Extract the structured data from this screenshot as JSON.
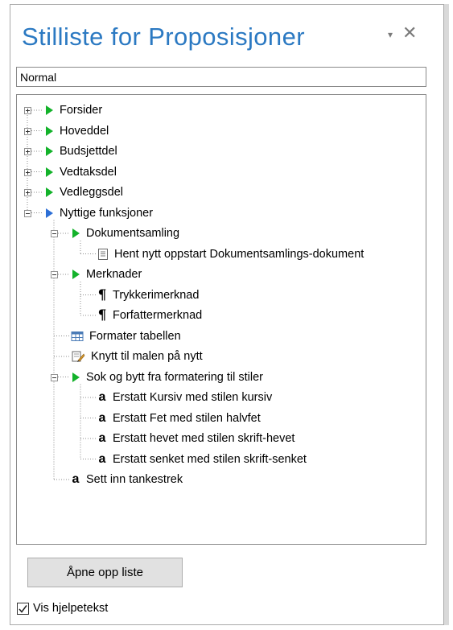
{
  "pane": {
    "title": "Stilliste for Proposisjoner",
    "dropdown_glyph": "▾",
    "close_glyph": "✕"
  },
  "style_input": {
    "value": "Normal"
  },
  "tree": {
    "items": [
      {
        "label": "Forsider",
        "icon": "green-triangle-icon",
        "expander": "plus"
      },
      {
        "label": "Hoveddel",
        "icon": "green-triangle-icon",
        "expander": "plus"
      },
      {
        "label": "Budsjettdel",
        "icon": "green-triangle-icon",
        "expander": "plus"
      },
      {
        "label": "Vedtaksdel",
        "icon": "green-triangle-icon",
        "expander": "plus"
      },
      {
        "label": "Vedleggsdel",
        "icon": "green-triangle-icon",
        "expander": "plus"
      },
      {
        "label": "Nyttige funksjoner",
        "icon": "blue-triangle-icon",
        "expander": "minus"
      },
      {
        "label": "Dokumentsamling",
        "icon": "green-triangle-icon",
        "expander": "minus"
      },
      {
        "label": "Hent nytt oppstart Dokumentsamlings-dokument",
        "icon": "document-icon"
      },
      {
        "label": "Merknader",
        "icon": "green-triangle-icon",
        "expander": "minus"
      },
      {
        "label": "Trykkerimerknad",
        "icon": "pilcrow-icon"
      },
      {
        "label": "Forfattermerknad",
        "icon": "pilcrow-icon"
      },
      {
        "label": "Formater tabellen",
        "icon": "table-icon"
      },
      {
        "label": "Knytt til malen på nytt",
        "icon": "attach-template-icon"
      },
      {
        "label": "Sok og bytt fra formatering til stiler",
        "icon": "green-triangle-icon",
        "expander": "minus"
      },
      {
        "label": "Erstatt Kursiv med stilen kursiv",
        "icon": "character-style-icon"
      },
      {
        "label": "Erstatt Fet med stilen halvfet",
        "icon": "character-style-icon"
      },
      {
        "label": "Erstatt hevet med stilen skrift-hevet",
        "icon": "character-style-icon"
      },
      {
        "label": "Erstatt senket med stilen skrift-senket",
        "icon": "character-style-icon"
      },
      {
        "label": "Sett inn tankestrek",
        "icon": "character-style-icon"
      }
    ],
    "char_glyph": "a",
    "para_glyph": "¶"
  },
  "open_button": {
    "label": "Åpne opp liste"
  },
  "help_checkbox": {
    "label": "Vis hjelpetekst",
    "checked": true
  },
  "colors": {
    "title": "#2b79c2",
    "green_triangle": "#13b22a",
    "blue_triangle": "#2d6fd6",
    "button_bg": "#e1e1e1"
  }
}
